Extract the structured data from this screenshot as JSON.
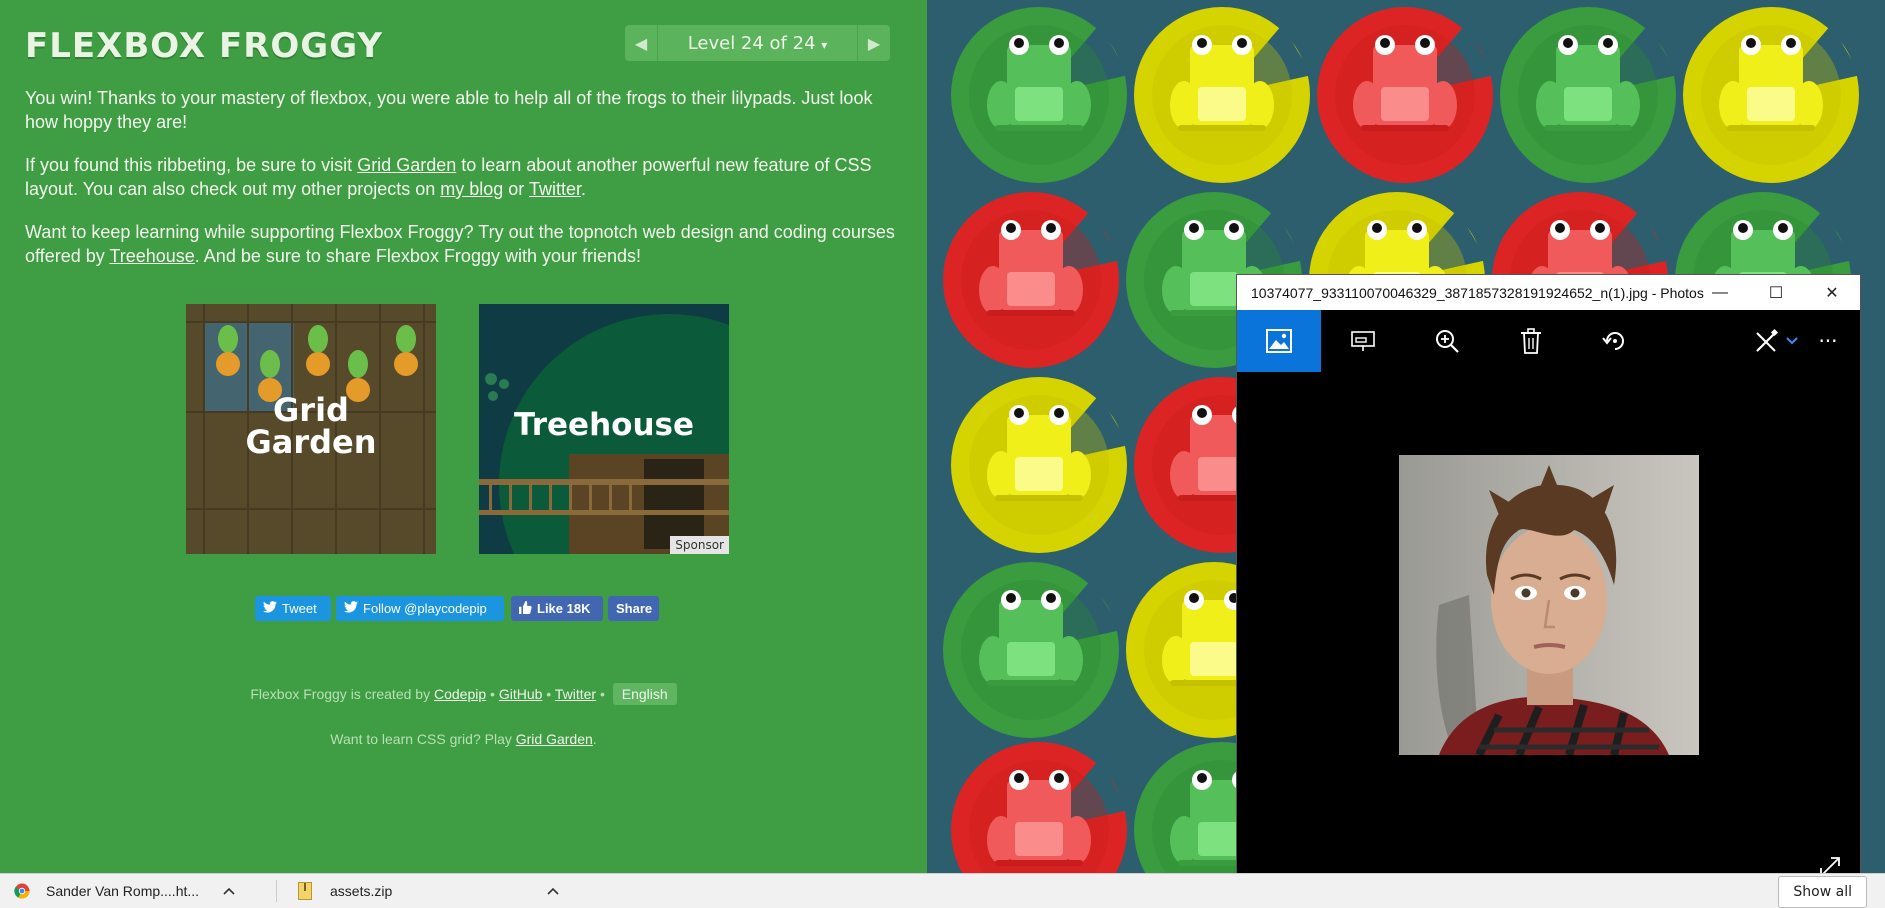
{
  "app": {
    "logo": "FLEXBOX FROGGY"
  },
  "level": {
    "label": "Level 24 of 24",
    "caret": "▾",
    "prev": "◀",
    "next": "▶"
  },
  "intro": {
    "p1": "You win! Thanks to your mastery of flexbox, you were able to help all of the frogs to their lilypads. Just look how hoppy they are!",
    "p2_a": "If you found this ribbeting, be sure to visit ",
    "p2_link1": "Grid Garden",
    "p2_b": " to learn about another powerful new feature of CSS layout. You can also check out my other projects on ",
    "p2_link2": "my blog",
    "p2_c": " or ",
    "p2_link3": "Twitter",
    "p2_d": ".",
    "p3_a": "Want to keep learning while supporting Flexbox Froggy? Try out the topnotch web design and coding courses offered by ",
    "p3_link": "Treehouse",
    "p3_b": ". And be sure to share Flexbox Froggy with your friends!"
  },
  "cards": {
    "grid_garden_line1": "Grid",
    "grid_garden_line2": "Garden",
    "treehouse": "Treehouse",
    "sponsor": "Sponsor"
  },
  "social": {
    "tweet": "Tweet",
    "follow": "Follow @playcodepip",
    "like": "Like 18K",
    "share": "Share"
  },
  "footer": {
    "created": "Flexbox Froggy is created by ",
    "codepip": "Codepip",
    "github": "GitHub",
    "twitter": "Twitter",
    "sep": " • ",
    "language": "English",
    "grid_text": "Want to learn CSS grid? Play ",
    "grid_link": "Grid Garden",
    "grid_end": "."
  },
  "photos": {
    "title": "10374077_933110070046329_3871857328191924652_n(1).jpg - Photos",
    "minimize": "—",
    "maximize": "☐",
    "close": "✕",
    "more": "···"
  },
  "taskbar": {
    "item1": "Sander Van Romp....ht...",
    "item2": "assets.zip",
    "show_all": "Show all"
  },
  "colors": {
    "green": "#3f9e44",
    "board": "#2c5e6e",
    "frog_green": "#44ad4b",
    "frog_yellow": "#d6d400",
    "frog_red": "#dd2424",
    "accent": "#0a74da"
  }
}
